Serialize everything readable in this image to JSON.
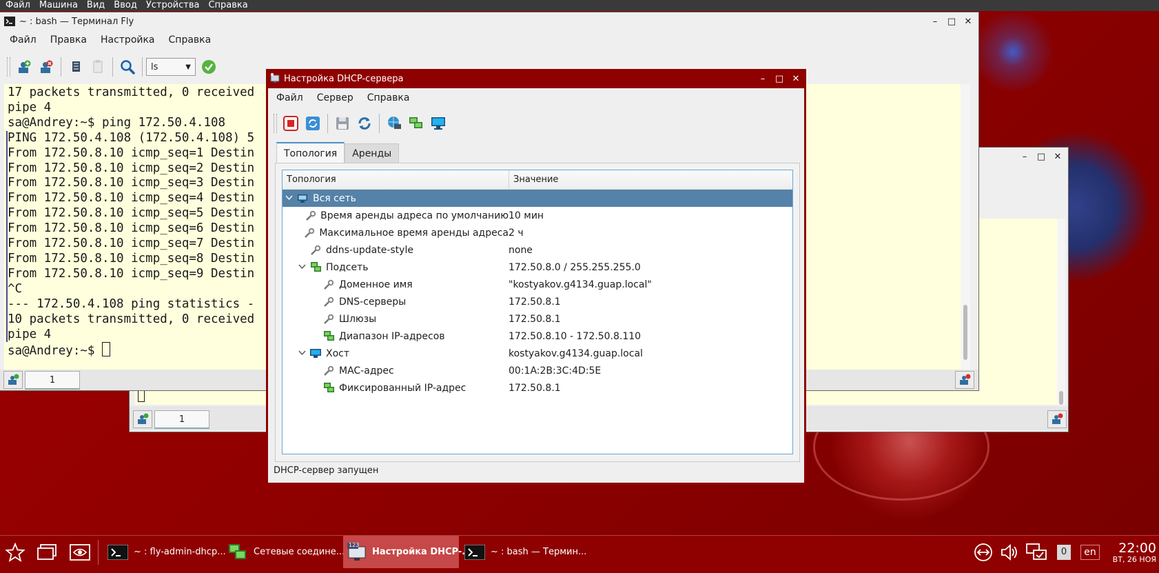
{
  "vm_menu": [
    "Файл",
    "Машина",
    "Вид",
    "Ввод",
    "Устройства",
    "Справка"
  ],
  "terminal": {
    "title": "~ : bash — Терминал Fly",
    "menu": [
      "Файл",
      "Правка",
      "Настройка",
      "Справка"
    ],
    "combo_value": "ls",
    "lines": [
      "17 packets transmitted, 0 received",
      "pipe 4",
      "sa@Andrey:~$ ping 172.50.4.108",
      "PING 172.50.4.108 (172.50.4.108) 5",
      "From 172.50.8.10 icmp_seq=1 Destin",
      "From 172.50.8.10 icmp_seq=2 Destin",
      "From 172.50.8.10 icmp_seq=3 Destin",
      "From 172.50.8.10 icmp_seq=4 Destin",
      "From 172.50.8.10 icmp_seq=5 Destin",
      "From 172.50.8.10 icmp_seq=6 Destin",
      "From 172.50.8.10 icmp_seq=7 Destin",
      "From 172.50.8.10 icmp_seq=8 Destin",
      "From 172.50.8.10 icmp_seq=9 Destin",
      "^C",
      "--- 172.50.4.108 ping statistics -",
      "10 packets transmitted, 0 received",
      "pipe 4"
    ],
    "prompt": "sa@Andrey:~$ ",
    "tab_label": "1"
  },
  "back_terminal": {
    "tab_label": "1"
  },
  "dhcp": {
    "title": "Настройка DHCP-сервера",
    "menu": [
      "Файл",
      "Сервер",
      "Справка"
    ],
    "tabs": [
      "Топология",
      "Аренды"
    ],
    "columns": [
      "Топология",
      "Значение"
    ],
    "rows": [
      {
        "label": "Вся сеть",
        "value": "",
        "level": 0,
        "icon": "network-icon",
        "expand": true,
        "selected": true
      },
      {
        "label": "Время аренды адреса по умолчанию",
        "value": "10 мин",
        "level": 1,
        "icon": "wrench-icon"
      },
      {
        "label": "Максимальное время аренды адреса",
        "value": "2 ч",
        "level": 1,
        "icon": "wrench-icon"
      },
      {
        "label": "ddns-update-style",
        "value": "none",
        "level": 1,
        "icon": "wrench-icon"
      },
      {
        "label": "Подсеть",
        "value": "172.50.8.0 / 255.255.255.0",
        "level": 1,
        "icon": "subnet-icon",
        "expand": true
      },
      {
        "label": "Доменное имя",
        "value": "\"kostyakov.g4134.guap.local\"",
        "level": 2,
        "icon": "wrench-icon"
      },
      {
        "label": "DNS-серверы",
        "value": "172.50.8.1",
        "level": 2,
        "icon": "wrench-icon"
      },
      {
        "label": "Шлюзы",
        "value": "172.50.8.1",
        "level": 2,
        "icon": "wrench-icon"
      },
      {
        "label": "Диапазон IP-адресов",
        "value": "172.50.8.10 - 172.50.8.110",
        "level": 2,
        "icon": "subnet-icon"
      },
      {
        "label": "Хост",
        "value": "kostyakov.g4134.guap.local",
        "level": 1,
        "icon": "host-icon",
        "expand": true
      },
      {
        "label": "MAC-адрес",
        "value": "00:1A:2B:3C:4D:5E",
        "level": 2,
        "icon": "wrench-icon"
      },
      {
        "label": "Фиксированный IP-адрес",
        "value": "172.50.8.1",
        "level": 2,
        "icon": "subnet-icon"
      }
    ],
    "status": "DHCP-сервер запущен"
  },
  "taskbar": {
    "tasks": [
      {
        "label": "~ : fly-admin-dhcp..."
      },
      {
        "label": "Сетевые соедине..."
      },
      {
        "label": "Настройка DHCP-..."
      },
      {
        "label": "~ : bash — Термин..."
      }
    ],
    "badge_count": "0",
    "lang": "en",
    "time": "22:00",
    "date": "ВТ, 26 НОЯ",
    "dhcp_icon_badge": "123"
  },
  "colors": {
    "desktop": "#8f0000",
    "selection": "#5582a8",
    "terminal_bg": "#ffffdd",
    "active_task": "#c64848"
  }
}
